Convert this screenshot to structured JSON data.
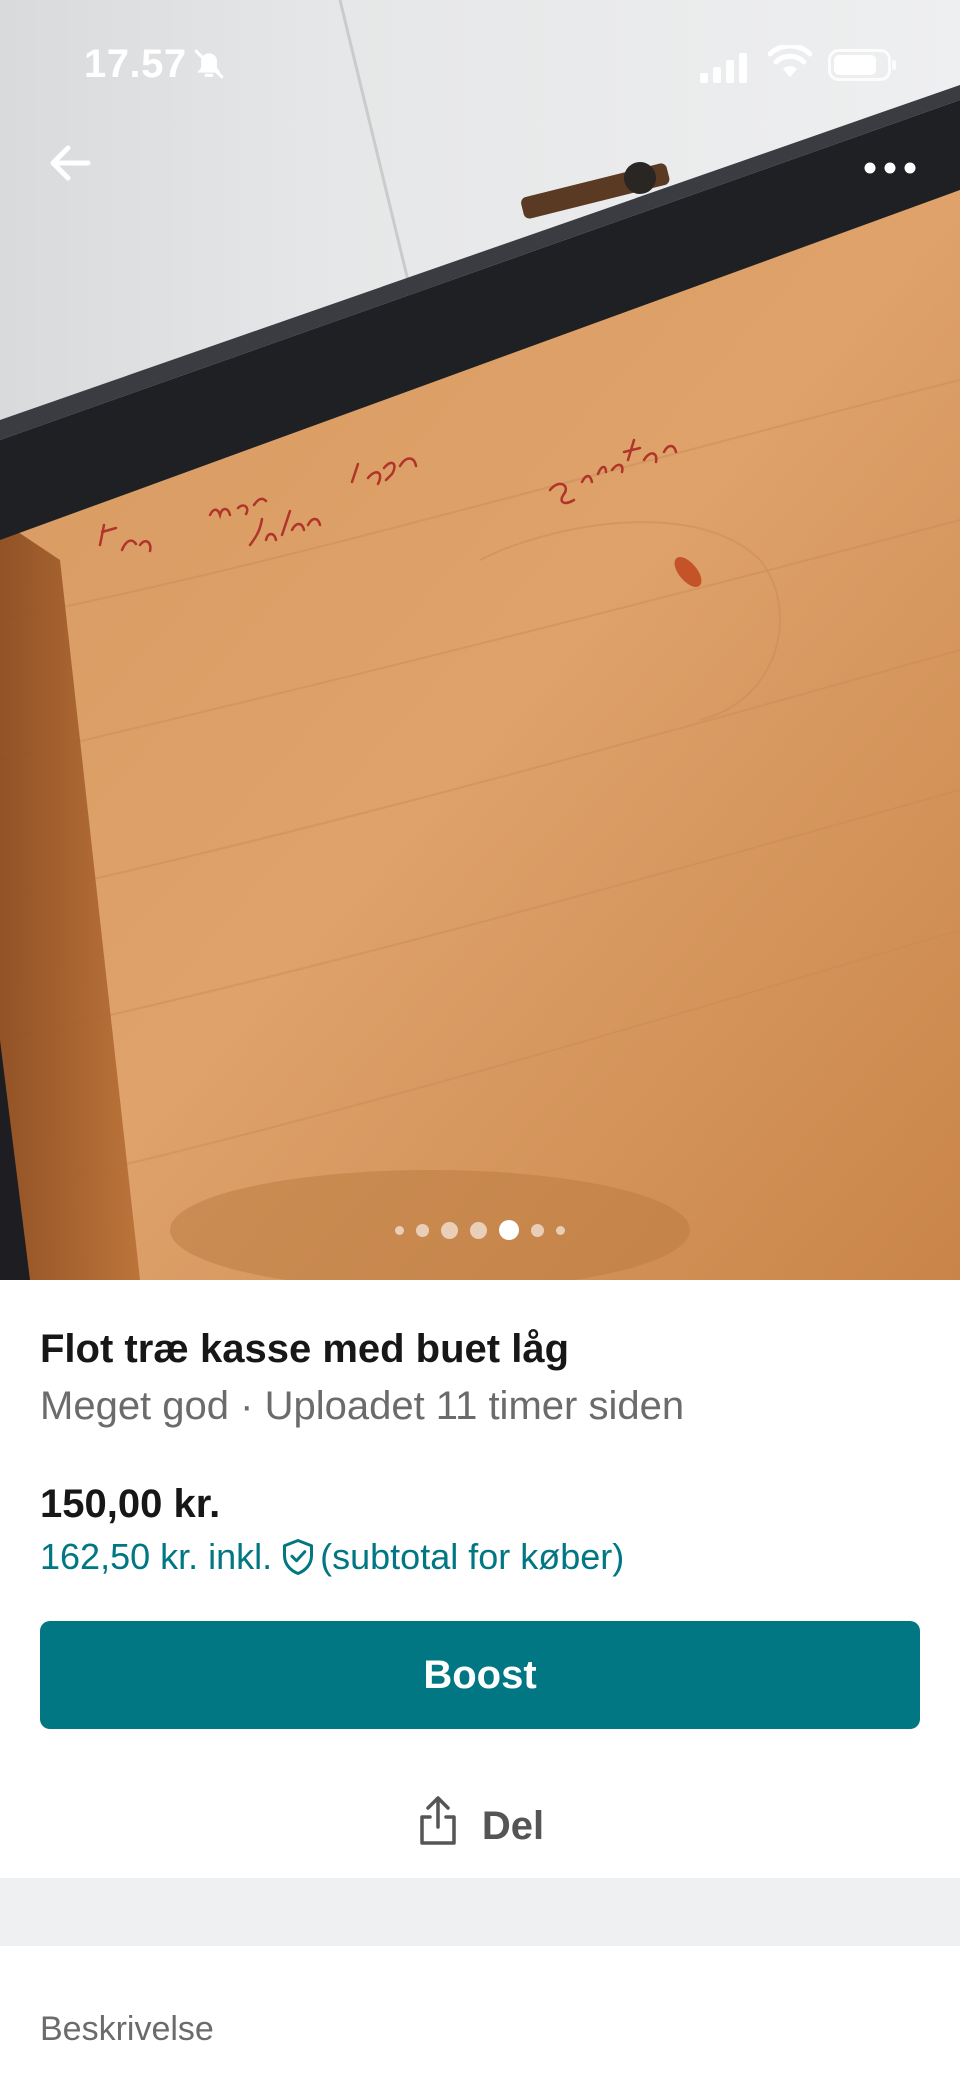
{
  "status_bar": {
    "time": "17.57",
    "icons": [
      "bell-slash-icon",
      "signal-icon",
      "wifi-icon",
      "battery-icon"
    ]
  },
  "navigation": {
    "back_icon": "arrow-left-icon",
    "more_icon": "more-horizontal-icon"
  },
  "gallery": {
    "image_count": 7,
    "active_index": 4
  },
  "listing": {
    "title": "Flot træ kasse med buet låg",
    "meta": "Meget god · Uploadet 11 timer siden",
    "price": "150,00 kr.",
    "buyer_price": "162,50 kr. inkl.",
    "buyer_note": "(subtotal for køber)"
  },
  "actions": {
    "boost_label": "Boost",
    "share_label": "Del"
  },
  "sections": {
    "description_label": "Beskrivelse"
  },
  "colors": {
    "accent": "#007782",
    "text_primary": "#171717",
    "text_secondary": "#6b6b6b",
    "separator": "#eef0f1"
  }
}
